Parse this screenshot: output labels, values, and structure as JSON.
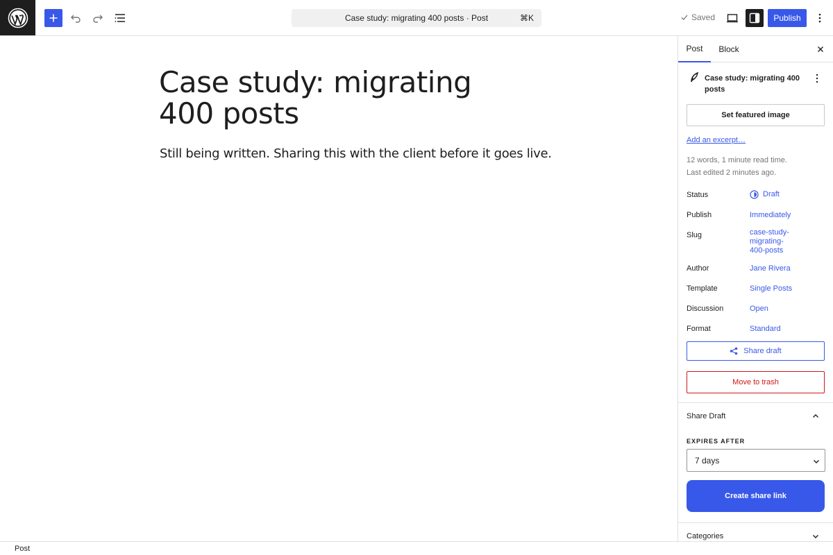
{
  "header": {
    "command_bar_title": "Case study: migrating 400 posts · Post",
    "command_shortcut": "⌘K",
    "saved_label": "Saved",
    "publish_label": "Publish"
  },
  "editor": {
    "title": "Case study: migrating 400 posts",
    "paragraph": "Still being written. Sharing this with the client before it goes live."
  },
  "sidebar": {
    "tabs": [
      {
        "label": "Post",
        "active": true
      },
      {
        "label": "Block",
        "active": false
      }
    ],
    "post_card_title": "Case study: migrating 400 posts",
    "featured_image_label": "Set featured image",
    "excerpt_link": "Add an excerpt…",
    "meta_line1": "12 words, 1 minute read time.",
    "meta_line2": "Last edited 2 minutes ago.",
    "rows": {
      "status": {
        "label": "Status",
        "value": "Draft"
      },
      "publish": {
        "label": "Publish",
        "value": "Immediately"
      },
      "slug": {
        "label": "Slug",
        "value_lines": [
          "case-study-",
          "migrating-",
          "400-posts"
        ]
      },
      "author": {
        "label": "Author",
        "value": "Jane Rivera"
      },
      "template": {
        "label": "Template",
        "value": "Single Posts"
      },
      "discussion": {
        "label": "Discussion",
        "value": "Open"
      },
      "format": {
        "label": "Format",
        "value": "Standard"
      }
    },
    "share_draft_button": "Share draft",
    "trash_button": "Move to trash",
    "share_panel": {
      "title": "Share Draft",
      "expires_label": "EXPIRES AFTER",
      "expires_value": "7 days",
      "create_button": "Create share link"
    },
    "categories_panel_title": "Categories"
  },
  "footer": {
    "breadcrumb": "Post"
  },
  "colors": {
    "accent": "#3858e9",
    "danger": "#cc1818",
    "dark": "#1e1e1e"
  }
}
